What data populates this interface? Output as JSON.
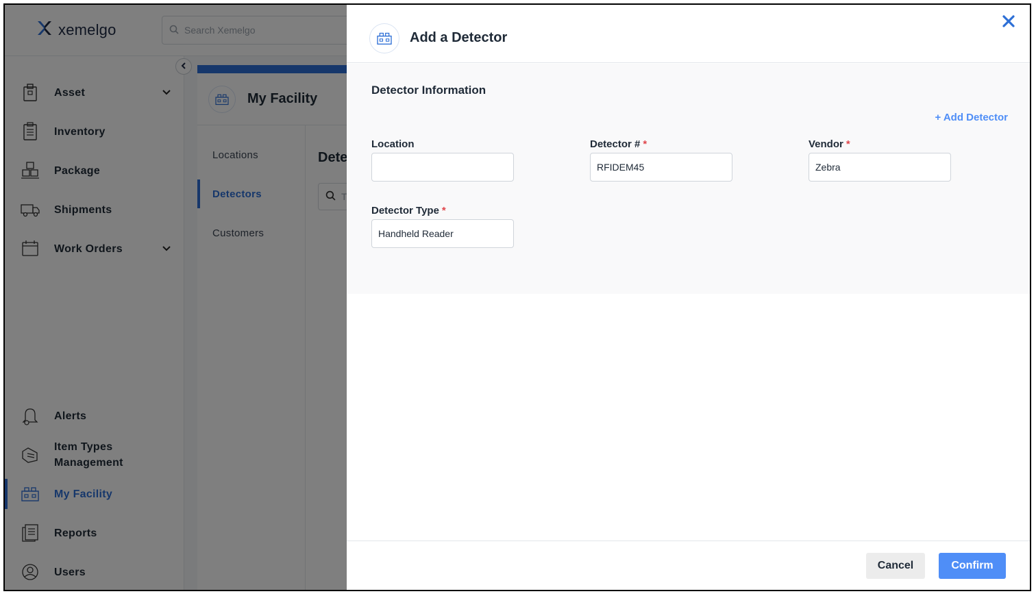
{
  "app": {
    "brand": "xemelgo",
    "search_placeholder": "Search Xemelgo"
  },
  "sidebar": {
    "items": [
      {
        "label": "Asset",
        "icon": "asset-icon",
        "has_chevron": true
      },
      {
        "label": "Inventory",
        "icon": "inventory-icon",
        "has_chevron": false
      },
      {
        "label": "Package",
        "icon": "package-icon",
        "has_chevron": false
      },
      {
        "label": "Shipments",
        "icon": "shipments-icon",
        "has_chevron": false
      },
      {
        "label": "Work Orders",
        "icon": "work-orders-icon",
        "has_chevron": true
      },
      {
        "label": "Alerts",
        "icon": "alerts-icon",
        "has_chevron": false
      },
      {
        "label": "Item Types Management",
        "icon": "item-types-icon",
        "has_chevron": false
      },
      {
        "label": "My Facility",
        "icon": "my-facility-icon",
        "has_chevron": false,
        "active": true
      },
      {
        "label": "Reports",
        "icon": "reports-icon",
        "has_chevron": false
      },
      {
        "label": "Users",
        "icon": "users-icon",
        "has_chevron": false
      }
    ]
  },
  "content": {
    "title": "My Facility",
    "subnav": [
      "Locations",
      "Detectors",
      "Customers"
    ],
    "active_subnav": "Detectors",
    "section_heading": "Dete",
    "search_placeholder": "T"
  },
  "modal": {
    "title": "Add a Detector",
    "section_title": "Detector Information",
    "add_link": "+ Add Detector",
    "fields": {
      "location": {
        "label": "Location",
        "required": false,
        "value": ""
      },
      "detector_number": {
        "label": "Detector #",
        "required": true,
        "value": "RFIDEM45"
      },
      "vendor": {
        "label": "Vendor",
        "required": true,
        "value": "Zebra"
      },
      "detector_type": {
        "label": "Detector Type",
        "required": true,
        "value": "Handheld Reader"
      }
    },
    "required_marker": "*",
    "cancel_label": "Cancel",
    "confirm_label": "Confirm"
  },
  "colors": {
    "accent": "#2d6fd6",
    "link": "#4f8ef7",
    "required": "#e0474c",
    "overlay": "rgba(0,0,0,0.5)"
  }
}
